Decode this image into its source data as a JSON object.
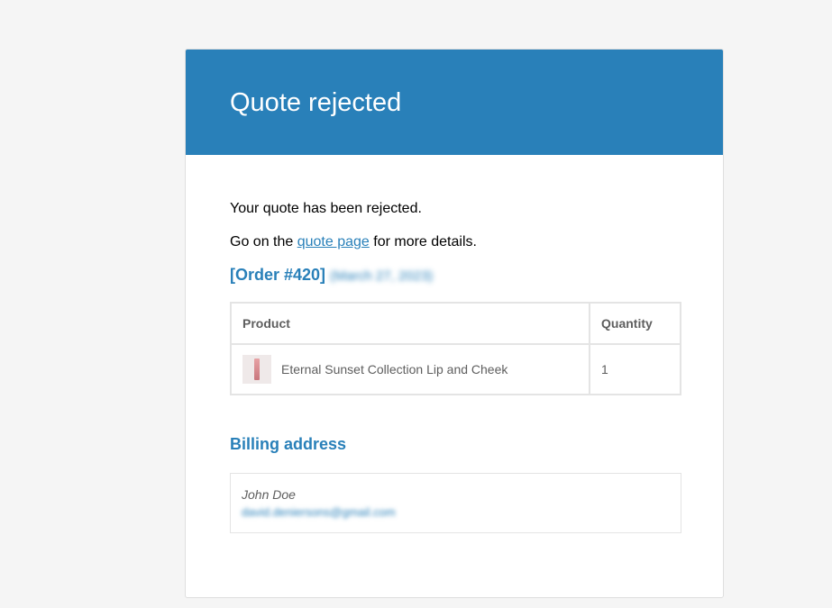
{
  "email": {
    "title": "Quote rejected",
    "intro": "Your quote has been rejected.",
    "details_prefix": "Go on the ",
    "details_link": "quote page",
    "details_suffix": " for more details.",
    "order_title": "[Order #420]",
    "order_date": "(March 27, 2023)",
    "table": {
      "headers": [
        "Product",
        "Quantity"
      ],
      "rows": [
        {
          "product": "Eternal Sunset Collection Lip and Cheek",
          "quantity": "1"
        }
      ]
    },
    "billing_title": "Billing address",
    "billing": {
      "name": "John Doe",
      "email": "david.deniersons@gmail.com"
    }
  },
  "colors": {
    "brand": "#2980b9",
    "background": "#f5f5f5",
    "text": "#5e5e5e"
  }
}
